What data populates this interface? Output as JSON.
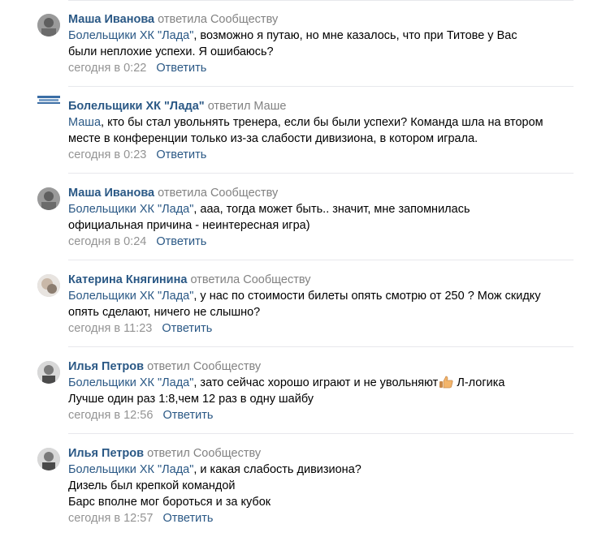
{
  "comments": [
    {
      "author": "Маша Иванова",
      "action": "ответила Сообществу",
      "mention": "Болельщики ХК \"Лада\"",
      "lines": [
        ", возможно я путаю, но мне казалось, что при Титове у Вас",
        "были неплохие успехи. Я ошибаюсь?"
      ],
      "time": "сегодня в 0:22",
      "reply": "Ответить",
      "avatar": "grey-photo-avatar"
    },
    {
      "author": "Болельщики ХК \"Лада\"",
      "action": "ответил Маше",
      "mention": "Маша",
      "lines": [
        ", кто бы стал увольнять тренера, если бы были успехи? Команда шла на втором",
        "месте в конференции только из-за слабости дивизиона, в котором играла."
      ],
      "time": "сегодня в 0:23",
      "reply": "Ответить",
      "avatar": "community-logo"
    },
    {
      "author": "Маша Иванова",
      "action": "ответила Сообществу",
      "mention": "Болельщики ХК \"Лада\"",
      "lines": [
        ", ааа, тогда может быть.. значит, мне запомнилась",
        "официальная причина - неинтересная игра)"
      ],
      "time": "сегодня в 0:24",
      "reply": "Ответить",
      "avatar": "grey-photo-avatar"
    },
    {
      "author": "Катерина Княгинина",
      "action": "ответила Сообществу",
      "mention": "Болельщики ХК \"Лада\"",
      "lines": [
        ", у нас по стоимости билеты опять смотрю от 250 ? Мож скидку",
        "опять сделают, ничего не слышно?"
      ],
      "time": "сегодня в 11:23",
      "reply": "Ответить",
      "avatar": "white-photo-avatar"
    },
    {
      "author": "Илья Петров",
      "action": "ответил Сообществу",
      "mention": "Болельщики ХК \"Лада\"",
      "lines": [
        ", зато сейчас хорошо играют и не увольняют",
        "Лучше один раз 1:8,чем 12 раз в одну шайбу"
      ],
      "line1_suffix": " Л-логика",
      "emoji": "thumbs-up-icon",
      "time": "сегодня в 12:56",
      "reply": "Ответить",
      "avatar": "mono-photo-avatar"
    },
    {
      "author": "Илья Петров",
      "action": "ответил Сообществу",
      "mention": "Болельщики ХК \"Лада\"",
      "lines": [
        ", и какая слабость дивизиона?",
        "Дизель был крепкой командой",
        "Барс вполне мог бороться и за кубок"
      ],
      "time": "сегодня в 12:57",
      "reply": "Ответить",
      "avatar": "mono-photo-avatar"
    }
  ],
  "colors": {
    "link": "#2a5885",
    "meta": "#939393",
    "divider": "#e7e8ec"
  }
}
